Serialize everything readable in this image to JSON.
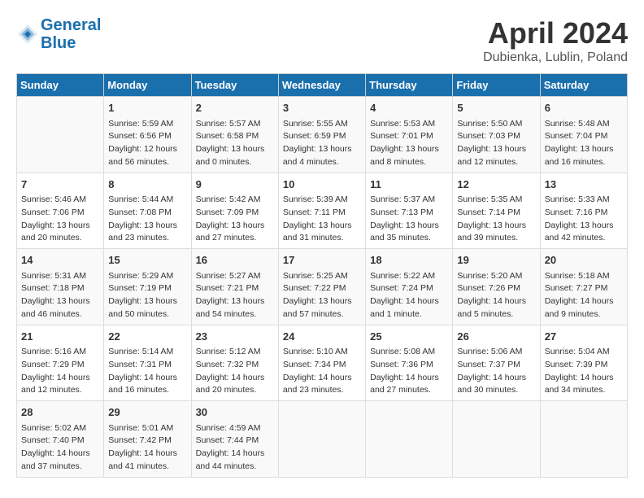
{
  "header": {
    "logo_line1": "General",
    "logo_line2": "Blue",
    "month_title": "April 2024",
    "subtitle": "Dubienka, Lublin, Poland"
  },
  "days_of_week": [
    "Sunday",
    "Monday",
    "Tuesday",
    "Wednesday",
    "Thursday",
    "Friday",
    "Saturday"
  ],
  "weeks": [
    [
      {
        "day": "",
        "info": ""
      },
      {
        "day": "1",
        "info": "Sunrise: 5:59 AM\nSunset: 6:56 PM\nDaylight: 12 hours\nand 56 minutes."
      },
      {
        "day": "2",
        "info": "Sunrise: 5:57 AM\nSunset: 6:58 PM\nDaylight: 13 hours\nand 0 minutes."
      },
      {
        "day": "3",
        "info": "Sunrise: 5:55 AM\nSunset: 6:59 PM\nDaylight: 13 hours\nand 4 minutes."
      },
      {
        "day": "4",
        "info": "Sunrise: 5:53 AM\nSunset: 7:01 PM\nDaylight: 13 hours\nand 8 minutes."
      },
      {
        "day": "5",
        "info": "Sunrise: 5:50 AM\nSunset: 7:03 PM\nDaylight: 13 hours\nand 12 minutes."
      },
      {
        "day": "6",
        "info": "Sunrise: 5:48 AM\nSunset: 7:04 PM\nDaylight: 13 hours\nand 16 minutes."
      }
    ],
    [
      {
        "day": "7",
        "info": "Sunrise: 5:46 AM\nSunset: 7:06 PM\nDaylight: 13 hours\nand 20 minutes."
      },
      {
        "day": "8",
        "info": "Sunrise: 5:44 AM\nSunset: 7:08 PM\nDaylight: 13 hours\nand 23 minutes."
      },
      {
        "day": "9",
        "info": "Sunrise: 5:42 AM\nSunset: 7:09 PM\nDaylight: 13 hours\nand 27 minutes."
      },
      {
        "day": "10",
        "info": "Sunrise: 5:39 AM\nSunset: 7:11 PM\nDaylight: 13 hours\nand 31 minutes."
      },
      {
        "day": "11",
        "info": "Sunrise: 5:37 AM\nSunset: 7:13 PM\nDaylight: 13 hours\nand 35 minutes."
      },
      {
        "day": "12",
        "info": "Sunrise: 5:35 AM\nSunset: 7:14 PM\nDaylight: 13 hours\nand 39 minutes."
      },
      {
        "day": "13",
        "info": "Sunrise: 5:33 AM\nSunset: 7:16 PM\nDaylight: 13 hours\nand 42 minutes."
      }
    ],
    [
      {
        "day": "14",
        "info": "Sunrise: 5:31 AM\nSunset: 7:18 PM\nDaylight: 13 hours\nand 46 minutes."
      },
      {
        "day": "15",
        "info": "Sunrise: 5:29 AM\nSunset: 7:19 PM\nDaylight: 13 hours\nand 50 minutes."
      },
      {
        "day": "16",
        "info": "Sunrise: 5:27 AM\nSunset: 7:21 PM\nDaylight: 13 hours\nand 54 minutes."
      },
      {
        "day": "17",
        "info": "Sunrise: 5:25 AM\nSunset: 7:22 PM\nDaylight: 13 hours\nand 57 minutes."
      },
      {
        "day": "18",
        "info": "Sunrise: 5:22 AM\nSunset: 7:24 PM\nDaylight: 14 hours\nand 1 minute."
      },
      {
        "day": "19",
        "info": "Sunrise: 5:20 AM\nSunset: 7:26 PM\nDaylight: 14 hours\nand 5 minutes."
      },
      {
        "day": "20",
        "info": "Sunrise: 5:18 AM\nSunset: 7:27 PM\nDaylight: 14 hours\nand 9 minutes."
      }
    ],
    [
      {
        "day": "21",
        "info": "Sunrise: 5:16 AM\nSunset: 7:29 PM\nDaylight: 14 hours\nand 12 minutes."
      },
      {
        "day": "22",
        "info": "Sunrise: 5:14 AM\nSunset: 7:31 PM\nDaylight: 14 hours\nand 16 minutes."
      },
      {
        "day": "23",
        "info": "Sunrise: 5:12 AM\nSunset: 7:32 PM\nDaylight: 14 hours\nand 20 minutes."
      },
      {
        "day": "24",
        "info": "Sunrise: 5:10 AM\nSunset: 7:34 PM\nDaylight: 14 hours\nand 23 minutes."
      },
      {
        "day": "25",
        "info": "Sunrise: 5:08 AM\nSunset: 7:36 PM\nDaylight: 14 hours\nand 27 minutes."
      },
      {
        "day": "26",
        "info": "Sunrise: 5:06 AM\nSunset: 7:37 PM\nDaylight: 14 hours\nand 30 minutes."
      },
      {
        "day": "27",
        "info": "Sunrise: 5:04 AM\nSunset: 7:39 PM\nDaylight: 14 hours\nand 34 minutes."
      }
    ],
    [
      {
        "day": "28",
        "info": "Sunrise: 5:02 AM\nSunset: 7:40 PM\nDaylight: 14 hours\nand 37 minutes."
      },
      {
        "day": "29",
        "info": "Sunrise: 5:01 AM\nSunset: 7:42 PM\nDaylight: 14 hours\nand 41 minutes."
      },
      {
        "day": "30",
        "info": "Sunrise: 4:59 AM\nSunset: 7:44 PM\nDaylight: 14 hours\nand 44 minutes."
      },
      {
        "day": "",
        "info": ""
      },
      {
        "day": "",
        "info": ""
      },
      {
        "day": "",
        "info": ""
      },
      {
        "day": "",
        "info": ""
      }
    ]
  ]
}
